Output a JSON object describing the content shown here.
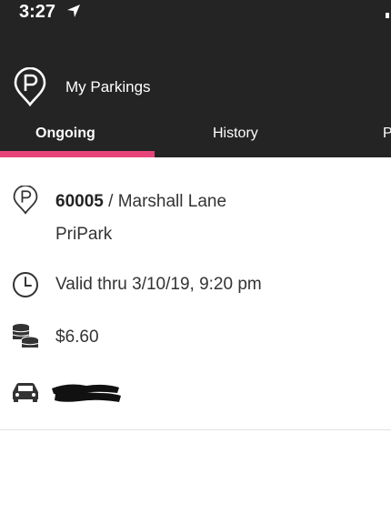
{
  "status_bar": {
    "time": "3:27"
  },
  "app": {
    "title": "My Parkings"
  },
  "tabs": [
    {
      "label": "Ongoing",
      "active": true
    },
    {
      "label": "History",
      "active": false
    },
    {
      "label": "P",
      "active": false
    }
  ],
  "colors": {
    "header_bg": "#242424",
    "accent": "#e7457a"
  },
  "parking": {
    "zone_code": "60005",
    "separator": " / ",
    "zone_name": "Marshall Lane",
    "operator": "PriPark",
    "validity": "Valid thru 3/10/19, 9:20 pm",
    "cost": "$6.60",
    "vehicle_plate_redacted": true
  },
  "icons": {
    "logo": "parking-pin-icon",
    "location": "parking-pin-icon",
    "time": "clock-icon",
    "cost": "coins-icon",
    "vehicle": "car-icon"
  }
}
